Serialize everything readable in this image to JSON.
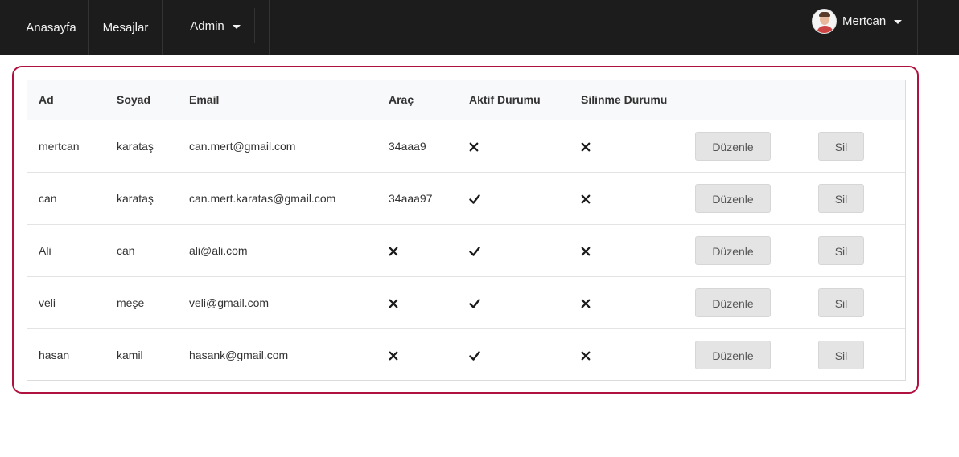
{
  "navbar": {
    "home": "Anasayfa",
    "messages": "Mesajlar",
    "admin": "Admin",
    "user_name": "Mertcan"
  },
  "table": {
    "headers": {
      "ad": "Ad",
      "soyad": "Soyad",
      "email": "Email",
      "arac": "Araç",
      "aktif": "Aktif Durumu",
      "silinme": "Silinme Durumu"
    },
    "edit_label": "Düzenle",
    "delete_label": "Sil",
    "rows": [
      {
        "ad": "mertcan",
        "soyad": "karataş",
        "email": "can.mert@gmail.com",
        "arac": "34aaa9",
        "arac_icon": null,
        "aktif": "cross-icon",
        "silinme": "cross-icon"
      },
      {
        "ad": "can",
        "soyad": "karataş",
        "email": "can.mert.karatas@gmail.com",
        "arac": "34aaa97",
        "arac_icon": null,
        "aktif": "check-icon",
        "silinme": "cross-icon"
      },
      {
        "ad": "Ali",
        "soyad": "can",
        "email": "ali@ali.com",
        "arac": null,
        "arac_icon": "cross-icon",
        "aktif": "check-icon",
        "silinme": "cross-icon"
      },
      {
        "ad": "veli",
        "soyad": "meşe",
        "email": "veli@gmail.com",
        "arac": null,
        "arac_icon": "cross-icon",
        "aktif": "check-icon",
        "silinme": "cross-icon"
      },
      {
        "ad": "hasan",
        "soyad": "kamil",
        "email": "hasank@gmail.com",
        "arac": null,
        "arac_icon": "cross-icon",
        "aktif": "check-icon",
        "silinme": "cross-icon"
      }
    ]
  }
}
